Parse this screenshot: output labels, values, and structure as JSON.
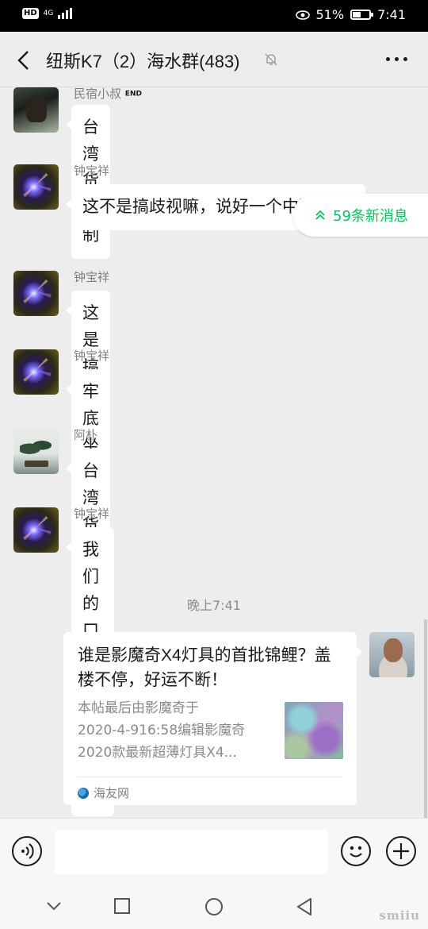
{
  "status_bar": {
    "hd": "HD",
    "network": "4G",
    "battery_percent": "51%",
    "battery_level": 0.51,
    "time": "7:41"
  },
  "header": {
    "title": "纽斯K7（2）海水群(483)"
  },
  "new_messages": {
    "label": "59条新消息"
  },
  "messages": [
    {
      "sender": "民宿小叔",
      "sender_tag": "END",
      "text": "台湾货抵制"
    },
    {
      "sender": "钟宝祥",
      "text": "这不是搞歧视嘛，说好一个中国的呢"
    },
    {
      "sender": "钟宝祥",
      "text": "这是搞分裂哟"
    },
    {
      "sender": "钟宝祥",
      "text": "牢底坐穿"
    },
    {
      "sender": "阿朴",
      "text": "台湾货不错"
    },
    {
      "sender": "钟宝祥",
      "text": "我们的口罩全球第一",
      "emoji": "🐶"
    }
  ],
  "time_divider": "晚上7:41",
  "link_card": {
    "title": "谁是影魔奇X4灯具的首批锦鲤？盖楼不停，好运不断！",
    "desc_lines": [
      "本帖最后由影魔奇于",
      "2020-4-916:58编辑影魔奇",
      "2020款最新超薄灯具X4..."
    ],
    "source": "海友网"
  },
  "watermark": "smiiu"
}
